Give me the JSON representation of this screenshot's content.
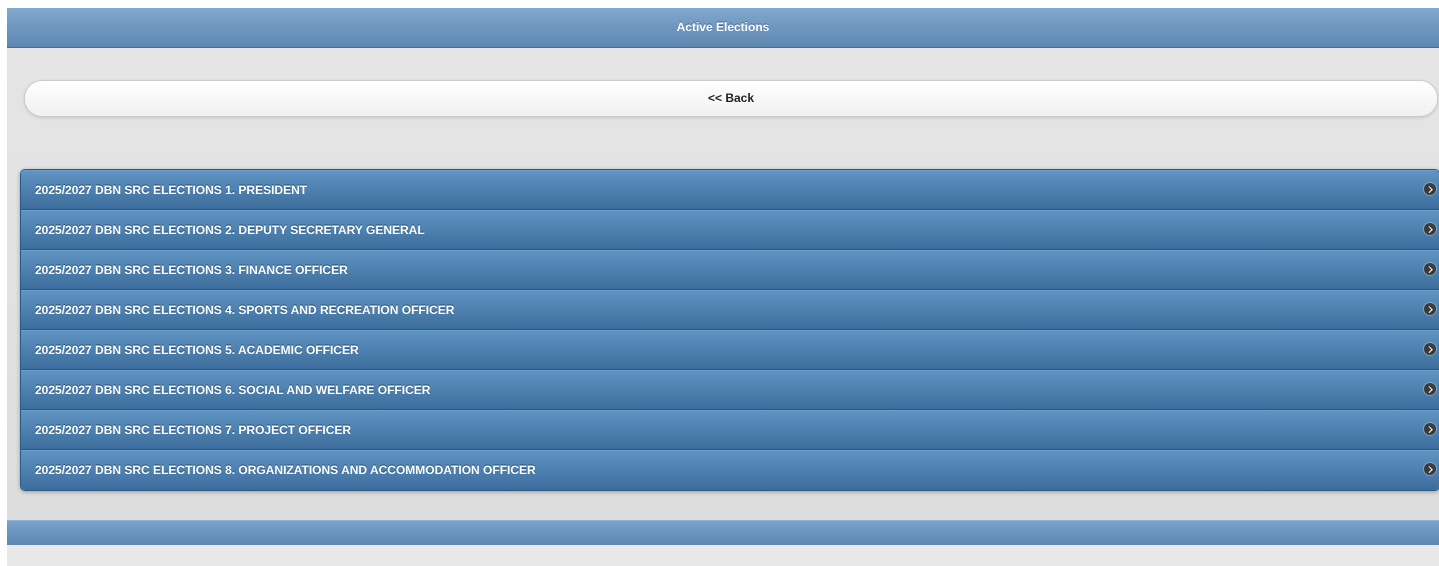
{
  "header": {
    "title": "Active Elections"
  },
  "back_button": {
    "label": "<< Back"
  },
  "elections": [
    {
      "label": "2025/2027 DBN SRC ELECTIONS 1. PRESIDENT",
      "icon": "chevron-right-circle-icon"
    },
    {
      "label": "2025/2027 DBN SRC ELECTIONS 2. DEPUTY SECRETARY GENERAL",
      "icon": "chevron-right-circle-icon"
    },
    {
      "label": "2025/2027 DBN SRC ELECTIONS 3. FINANCE OFFICER",
      "icon": "chevron-right-circle-icon"
    },
    {
      "label": "2025/2027 DBN SRC ELECTIONS 4. SPORTS AND RECREATION OFFICER",
      "icon": "chevron-right-circle-icon"
    },
    {
      "label": "2025/2027 DBN SRC ELECTIONS 5. ACADEMIC OFFICER",
      "icon": "chevron-right-circle-icon"
    },
    {
      "label": "2025/2027 DBN SRC ELECTIONS 6. SOCIAL AND WELFARE OFFICER",
      "icon": "chevron-right-circle-icon"
    },
    {
      "label": "2025/2027 DBN SRC ELECTIONS 7. PROJECT OFFICER",
      "icon": "chevron-right-circle-icon"
    },
    {
      "label": "2025/2027 DBN SRC ELECTIONS 8. ORGANIZATIONS AND ACCOMMODATION OFFICER",
      "icon": "chevron-right-circle-icon"
    }
  ],
  "colors": {
    "header_bar": "#6f97bf",
    "list_item": "#4a7aa8",
    "page_background": "#e0e0e0",
    "back_button": "#f8f8f8"
  }
}
